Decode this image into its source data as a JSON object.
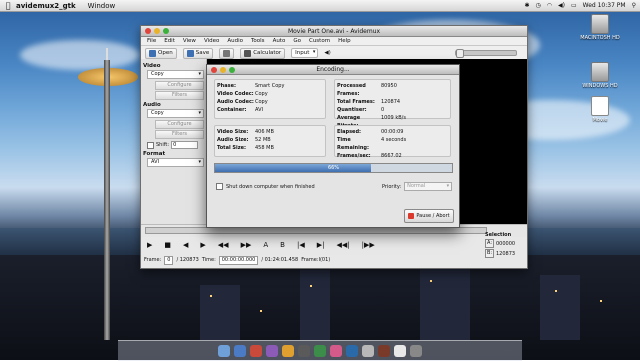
{
  "menubar": {
    "apple": "",
    "app_name": "avidemux2_gtk",
    "menu_window": "Window",
    "clock": "Wed 10:37 PM",
    "status_icons": [
      "bluetooth-icon",
      "clock-icon",
      "wifi-icon",
      "volume-icon",
      "battery-icon",
      "spotlight-icon"
    ]
  },
  "desktop": {
    "icons": [
      {
        "label": "MACINTOSH HD",
        "kind": "drive"
      },
      {
        "label": "WINDOWS HD",
        "kind": "drive"
      },
      {
        "label": "Movie",
        "kind": "doc"
      }
    ]
  },
  "main_window": {
    "title": "Movie Part One.avi - Avidemux",
    "menus": [
      "File",
      "Edit",
      "View",
      "Video",
      "Audio",
      "Tools",
      "Auto",
      "Go",
      "Custom",
      "Help"
    ],
    "toolbar": {
      "open": "Open",
      "save": "Save",
      "calculator": "Calculator",
      "input_select": "Input"
    },
    "left_panel": {
      "video_header": "Video",
      "video_codec": "Copy",
      "video_configure": "Configure",
      "video_filters": "Filters",
      "audio_header": "Audio",
      "audio_codec": "Copy",
      "audio_configure": "Configure",
      "audio_filters": "Filters",
      "shift_label": "Shift:",
      "shift_value": "0",
      "format_header": "Format",
      "format_value": "AVI"
    },
    "frame_bar": {
      "frame_label": "Frame:",
      "frame_value": "0",
      "frame_total": "/ 120873",
      "time_label": "Time:",
      "time_value": "00:00:00.000",
      "time_total": "/ 01:24:01.458",
      "frame_type": "Frame:I(01)"
    },
    "selection": {
      "label": "Selection",
      "a_label": "A:",
      "a_value": "000000",
      "b_label": "B:",
      "b_value": "120873"
    }
  },
  "encoding_dialog": {
    "title": "Encoding...",
    "left_info": [
      {
        "key": "Phase:",
        "value": "Smart Copy"
      },
      {
        "key": "Video Codec:",
        "value": "Copy"
      },
      {
        "key": "Audio Codec:",
        "value": "Copy"
      },
      {
        "key": "Container:",
        "value": "AVI"
      }
    ],
    "right_info": [
      {
        "key": "Processed Frames:",
        "value": "80950"
      },
      {
        "key": "Total Frames:",
        "value": "120874"
      },
      {
        "key": "Quantiser:",
        "value": "0"
      },
      {
        "key": "Average Bitrate:",
        "value": "1009 kB/s"
      }
    ],
    "size_info": [
      {
        "key": "Video Size:",
        "value": "406 MB"
      },
      {
        "key": "Audio Size:",
        "value": "52 MB"
      },
      {
        "key": "Total Size:",
        "value": "458 MB"
      }
    ],
    "time_info": [
      {
        "key": "Elapsed:",
        "value": "00:00:09"
      },
      {
        "key": "Time Remaining:",
        "value": "4 seconds"
      },
      {
        "key": "Frames/sec:",
        "value": "8667.02"
      }
    ],
    "progress_text": "66%",
    "progress_fraction": 0.66,
    "shutdown_label": "Shut down computer when finished",
    "priority_label": "Priority:",
    "priority_value": "Normal",
    "pause_abort_label": "Pause / Abort"
  },
  "colors": {
    "accent": "#3f6fb0",
    "close": "#e0443a",
    "minimize": "#e8b22a",
    "maximize": "#3cb13b"
  }
}
